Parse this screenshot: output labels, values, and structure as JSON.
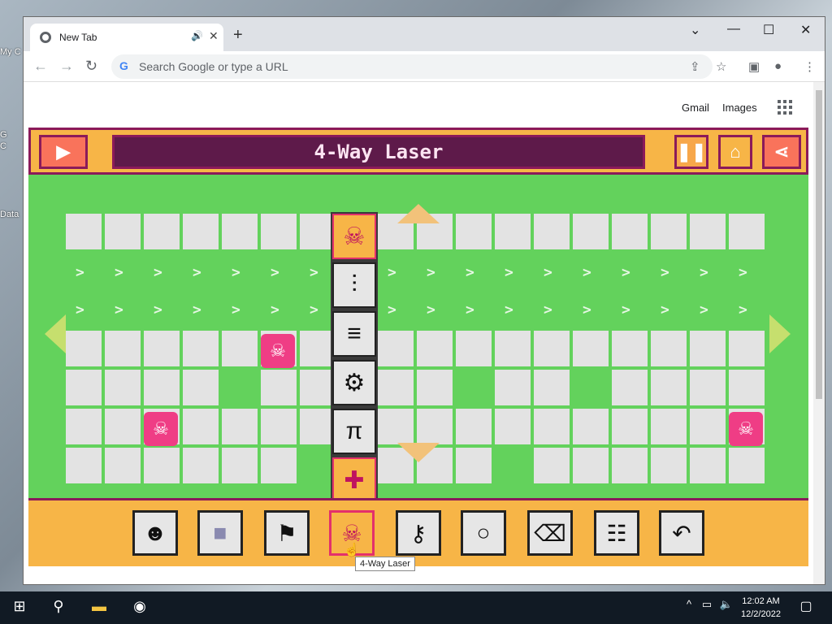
{
  "desktop": {
    "icons": [
      "My C",
      "G",
      "C",
      "Data"
    ]
  },
  "browser": {
    "tab_title": "New Tab",
    "omnibox_placeholder": "Search Google or type a URL",
    "links": {
      "gmail": "Gmail",
      "images": "Images"
    }
  },
  "game": {
    "title": "4-Way Laser",
    "tooltip": "4-Way Laser",
    "icons": {
      "play": "play-icon",
      "pause": "pause-icon",
      "home": "home-icon",
      "share": "share-icon"
    },
    "palette": [
      "laser-skull-icon",
      "spikes-h-icon",
      "spikes-v-icon",
      "gear-block-icon",
      "walker-icon",
      "health-cross-icon"
    ],
    "toolbar": [
      "character-icon",
      "block-icon",
      "flag-icon",
      "laser-skull-icon",
      "key-icon",
      "ring-icon",
      "eraser-icon",
      "settings-icon",
      "undo-icon"
    ],
    "colors": {
      "grass": "#63d25c",
      "bar": "#f7b547",
      "border": "#8b1a5a",
      "enemy": "#ef3d85",
      "tile": "#e3e3e3"
    }
  },
  "taskbar": {
    "time": "12:02 AM",
    "date": "12/2/2022"
  }
}
